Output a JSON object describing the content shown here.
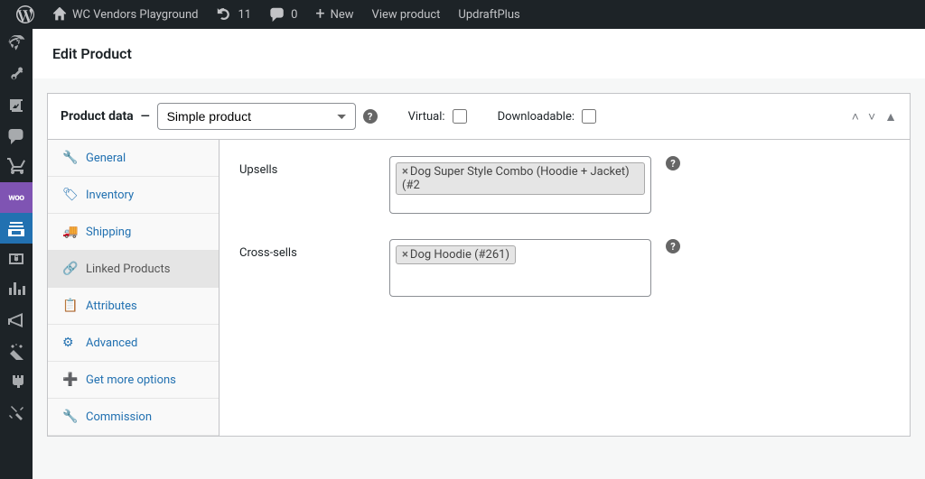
{
  "admin_bar": {
    "site_title": "WC Vendors Playground",
    "updates_count": "11",
    "comments_count": "0",
    "new_label": "New",
    "view_product_label": "View product",
    "updraft_label": "UpdraftPlus"
  },
  "page": {
    "title": "Edit Product"
  },
  "panel": {
    "title_prefix": "Product data",
    "title_sep": "—",
    "dropdown_value": "Simple product",
    "virtual_label": "Virtual:",
    "downloadable_label": "Downloadable:"
  },
  "tabs": [
    {
      "label": "General"
    },
    {
      "label": "Inventory"
    },
    {
      "label": "Shipping"
    },
    {
      "label": "Linked Products"
    },
    {
      "label": "Attributes"
    },
    {
      "label": "Advanced"
    },
    {
      "label": "Get more options"
    },
    {
      "label": "Commission"
    }
  ],
  "linked": {
    "upsells_label": "Upsells",
    "upsells_tokens": [
      "Dog Super Style Combo (Hoodie + Jacket) (#2"
    ],
    "cross_sells_label": "Cross-sells",
    "cross_sells_tokens": [
      "Dog Hoodie (#261)"
    ]
  }
}
